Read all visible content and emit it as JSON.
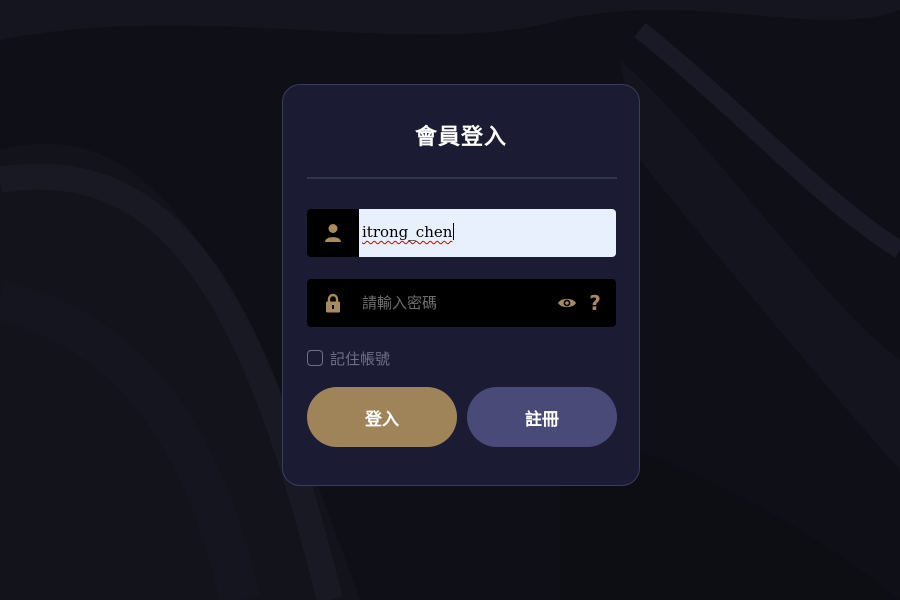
{
  "login_form": {
    "title": "會員登入",
    "username": {
      "value": "itrong_chen",
      "icon": "user-icon"
    },
    "password": {
      "value": "",
      "placeholder": "請輸入密碼",
      "icon": "lock-icon",
      "show_password_icon": "eye-icon",
      "help_icon": "question-icon",
      "help_label": "?"
    },
    "remember_me": {
      "label": "記住帳號",
      "checked": false
    },
    "buttons": {
      "login_label": "登入",
      "register_label": "註冊"
    }
  },
  "colors": {
    "background": "#0f0f17",
    "card": "#1b1c33",
    "accent_gold": "#9f8459",
    "register_purple": "#4a4a78",
    "autofill_field": "#e8f0fe"
  }
}
